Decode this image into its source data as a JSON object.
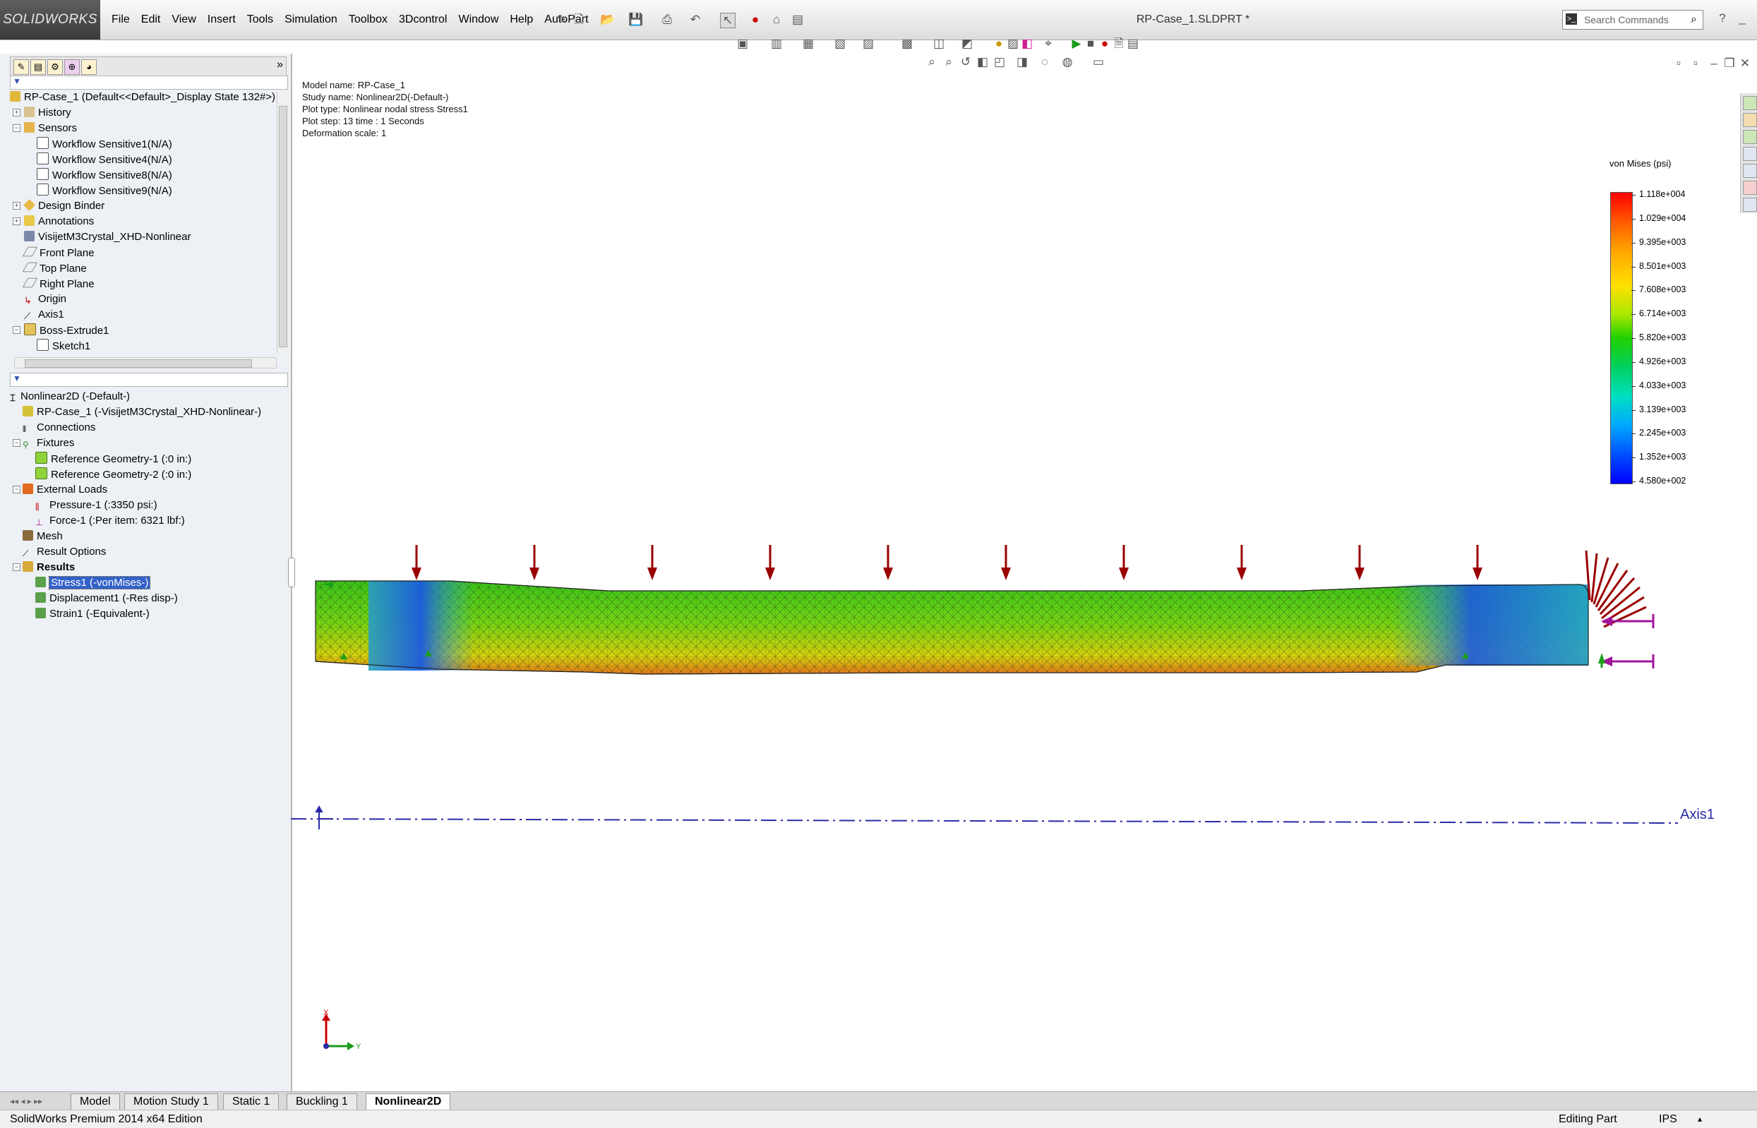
{
  "app": {
    "brand": "SOLIDWORKS",
    "document_title": "RP-Case_1.SLDPRT *"
  },
  "menu": [
    "File",
    "Edit",
    "View",
    "Insert",
    "Tools",
    "Simulation",
    "Toolbox",
    "3Dcontrol",
    "Window",
    "Help",
    "AutoPart"
  ],
  "search": {
    "placeholder": "Search Commands"
  },
  "feature_tree": {
    "root": "RP-Case_1  (Default<<Default>_Display State 132#>)",
    "items": [
      {
        "label": "History",
        "icon": "history-icon"
      },
      {
        "label": "Sensors",
        "icon": "sensors-icon"
      },
      {
        "label": "Workflow Sensitive1(N/A)",
        "icon": "sketch-icon"
      },
      {
        "label": "Workflow Sensitive4(N/A)",
        "icon": "sketch-icon"
      },
      {
        "label": "Workflow Sensitive8(N/A)",
        "icon": "sketch-icon"
      },
      {
        "label": "Workflow Sensitive9(N/A)",
        "icon": "sketch-icon"
      },
      {
        "label": "Design Binder",
        "icon": "binder-icon"
      },
      {
        "label": "Annotations",
        "icon": "annotations-icon"
      },
      {
        "label": "VisijetM3Crystal_XHD-Nonlinear",
        "icon": "material-icon"
      },
      {
        "label": "Front Plane",
        "icon": "plane-icon"
      },
      {
        "label": "Top Plane",
        "icon": "plane-icon"
      },
      {
        "label": "Right Plane",
        "icon": "plane-icon"
      },
      {
        "label": "Origin",
        "icon": "origin-icon"
      },
      {
        "label": "Axis1",
        "icon": "axis-icon"
      },
      {
        "label": "Boss-Extrude1",
        "icon": "extrude-icon"
      },
      {
        "label": "Sketch1",
        "icon": "sketch-icon"
      }
    ]
  },
  "study_tree": {
    "root": "Nonlinear2D (-Default-)",
    "items": [
      {
        "label": "RP-Case_1 (-VisijetM3Crystal_XHD-Nonlinear-)"
      },
      {
        "label": "Connections"
      },
      {
        "label": "Fixtures"
      },
      {
        "label": "Reference Geometry-1 (:0 in:)"
      },
      {
        "label": "Reference Geometry-2 (:0 in:)"
      },
      {
        "label": "External Loads"
      },
      {
        "label": "Pressure-1 (:3350 psi:)"
      },
      {
        "label": "Force-1 (:Per item: 6321 lbf:)"
      },
      {
        "label": "Mesh"
      },
      {
        "label": "Result Options"
      },
      {
        "label": "Results"
      },
      {
        "label": "Stress1 (-vonMises-)"
      },
      {
        "label": "Displacement1 (-Res disp-)"
      },
      {
        "label": "Strain1 (-Equivalent-)"
      }
    ]
  },
  "plot_info": {
    "model_name": "Model name: RP-Case_1",
    "study_name": "Study name: Nonlinear2D(-Default-)",
    "plot_type": "Plot type: Nonlinear nodal stress Stress1",
    "plot_step": "Plot step: 13   time : 1 Seconds",
    "deformation_scale": "Deformation scale: 1"
  },
  "legend": {
    "title": "von Mises (psi)",
    "values": [
      "1.118e+004",
      "1.029e+004",
      "9.395e+003",
      "8.501e+003",
      "7.608e+003",
      "6.714e+003",
      "5.820e+003",
      "4.926e+003",
      "4.033e+003",
      "3.139e+003",
      "2.245e+003",
      "1.352e+003",
      "4.580e+002"
    ]
  },
  "viewport": {
    "axis_label": "Axis1",
    "triad_x": "X",
    "triad_y": "Y"
  },
  "bottom_tabs": [
    "Model",
    "Motion Study 1",
    "Static 1",
    "Buckling 1",
    "Nonlinear2D"
  ],
  "status": {
    "edition": "SolidWorks Premium 2014 x64 Edition",
    "mode": "Editing Part",
    "units": "IPS"
  },
  "colors": {
    "arrow_red": "#9a0000",
    "axis_blue": "#2a2aa8",
    "selection": "#3261c9"
  }
}
